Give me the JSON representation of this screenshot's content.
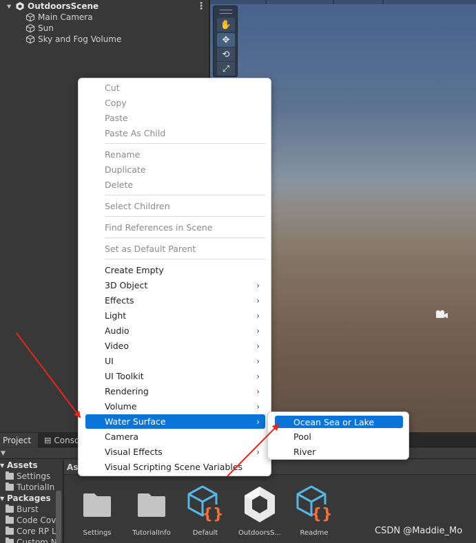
{
  "hierarchy": {
    "scene_name": "OutdoorsScene",
    "items": [
      {
        "label": "Main Camera",
        "icon": "gameobject-cube-icon"
      },
      {
        "label": "Sun",
        "icon": "gameobject-cube-icon"
      },
      {
        "label": "Sky and Fog Volume",
        "icon": "gameobject-cube-icon"
      }
    ],
    "menu_icon": "⋮"
  },
  "scene_tools": [
    {
      "name": "hand-tool",
      "glyph": "✋"
    },
    {
      "name": "move-tool",
      "glyph": "✥"
    },
    {
      "name": "rotate-tool",
      "glyph": "⟲"
    },
    {
      "name": "scale-tool",
      "glyph": "⤢"
    }
  ],
  "context_menu": {
    "groups": [
      [
        {
          "label": "Cut",
          "disabled": true
        },
        {
          "label": "Copy",
          "disabled": true
        },
        {
          "label": "Paste",
          "disabled": true
        },
        {
          "label": "Paste As Child",
          "disabled": true
        }
      ],
      [
        {
          "label": "Rename",
          "disabled": true
        },
        {
          "label": "Duplicate",
          "disabled": true
        },
        {
          "label": "Delete",
          "disabled": true
        }
      ],
      [
        {
          "label": "Select Children",
          "disabled": true
        }
      ],
      [
        {
          "label": "Find References in Scene",
          "disabled": true
        }
      ],
      [
        {
          "label": "Set as Default Parent",
          "disabled": true
        }
      ],
      [
        {
          "label": "Create Empty"
        },
        {
          "label": "3D Object",
          "submenu": true
        },
        {
          "label": "Effects",
          "submenu": true
        },
        {
          "label": "Light",
          "submenu": true
        },
        {
          "label": "Audio",
          "submenu": true
        },
        {
          "label": "Video",
          "submenu": true
        },
        {
          "label": "UI",
          "submenu": true
        },
        {
          "label": "UI Toolkit",
          "submenu": true
        },
        {
          "label": "Rendering",
          "submenu": true
        },
        {
          "label": "Volume",
          "submenu": true
        },
        {
          "label": "Water Surface",
          "submenu": true,
          "highlighted": true
        },
        {
          "label": "Camera"
        },
        {
          "label": "Visual Effects",
          "submenu": true
        },
        {
          "label": "Visual Scripting Scene Variables"
        }
      ]
    ],
    "submenu_arrow": "›"
  },
  "water_submenu": {
    "items": [
      {
        "label": "Ocean Sea or Lake",
        "highlighted": true
      },
      {
        "label": "Pool"
      },
      {
        "label": "River"
      }
    ]
  },
  "bottom_panel": {
    "tabs": [
      "Project",
      "Conso"
    ],
    "tree": [
      {
        "label": "Assets",
        "header": true
      },
      {
        "label": "Settings"
      },
      {
        "label": "TutorialIn"
      },
      {
        "label": "Packages",
        "header": true
      },
      {
        "label": "Burst"
      },
      {
        "label": "Code Cov"
      },
      {
        "label": "Core RP L"
      },
      {
        "label": "Custom N"
      }
    ],
    "grid_header": "As",
    "assets": [
      {
        "label": "Settings",
        "type": "folder"
      },
      {
        "label": "TutorialInfo",
        "type": "folder"
      },
      {
        "label": "Default",
        "type": "script-asset"
      },
      {
        "label": "OutdoorsS...",
        "type": "unity-scene"
      },
      {
        "label": "Readme",
        "type": "script-asset"
      }
    ]
  },
  "watermark": "CSDN @Maddie_Mo",
  "colors": {
    "highlight": "#0a74d8",
    "annotation_arrow": "#e8241c",
    "asset_icon_blue": "#56b6e6",
    "asset_icon_orange": "#f0723a"
  }
}
